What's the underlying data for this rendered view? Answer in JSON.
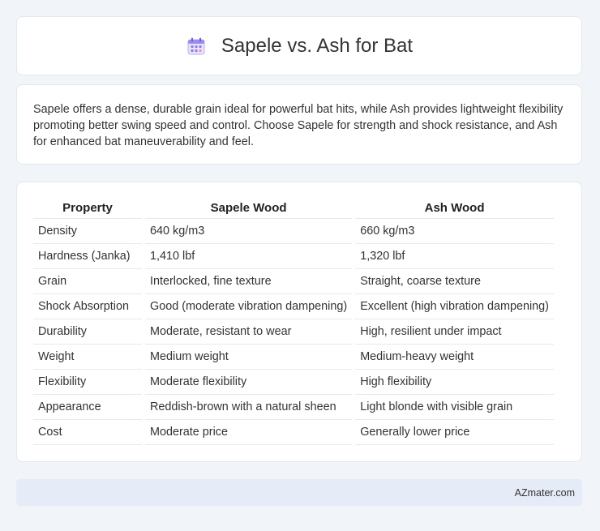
{
  "header": {
    "title": "Sapele vs. Ash for Bat",
    "icon": "calendar-icon"
  },
  "summary": {
    "text": "Sapele offers a dense, durable grain ideal for powerful bat hits, while Ash provides lightweight flexibility promoting better swing speed and control. Choose Sapele for strength and shock resistance, and Ash for enhanced bat maneuverability and feel."
  },
  "table": {
    "headers": [
      "Property",
      "Sapele Wood",
      "Ash Wood"
    ],
    "rows": [
      [
        "Density",
        "640 kg/m3",
        "660 kg/m3"
      ],
      [
        "Hardness (Janka)",
        "1,410 lbf",
        "1,320 lbf"
      ],
      [
        "Grain",
        "Interlocked, fine texture",
        "Straight, coarse texture"
      ],
      [
        "Shock Absorption",
        "Good (moderate vibration dampening)",
        "Excellent (high vibration dampening)"
      ],
      [
        "Durability",
        "Moderate, resistant to wear",
        "High, resilient under impact"
      ],
      [
        "Weight",
        "Medium weight",
        "Medium-heavy weight"
      ],
      [
        "Flexibility",
        "Moderate flexibility",
        "High flexibility"
      ],
      [
        "Appearance",
        "Reddish-brown with a natural sheen",
        "Light blonde with visible grain"
      ],
      [
        "Cost",
        "Moderate price",
        "Generally lower price"
      ]
    ]
  },
  "footer": {
    "brand": "AZmater.com"
  }
}
